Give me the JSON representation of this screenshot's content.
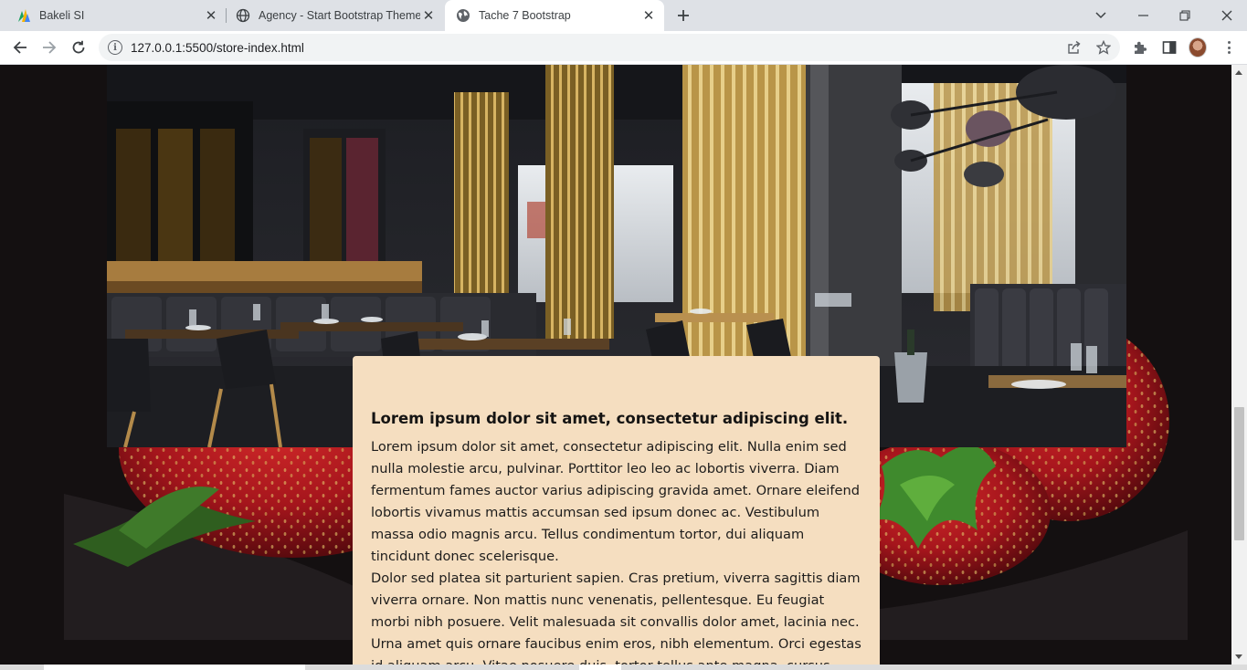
{
  "browser": {
    "tabs": [
      {
        "title": "Bakeli SI",
        "favicon": "bakeli-logo-icon",
        "active": false
      },
      {
        "title": "Agency - Start Bootstrap Theme",
        "favicon": "globe-icon",
        "active": false
      },
      {
        "title": "Tache 7 Bootstrap",
        "favicon": "globe-icon",
        "active": true
      }
    ],
    "address_bar": {
      "url": "127.0.0.1:5500/store-index.html"
    }
  },
  "page": {
    "card": {
      "heading": "Lorem ipsum dolor sit amet, consectetur adipiscing elit.",
      "paragraph1": "Lorem ipsum dolor sit amet, consectetur adipiscing elit. Nulla enim sed nulla molestie arcu, pulvinar. Porttitor leo leo ac lobortis viverra. Diam fermentum fames auctor varius adipiscing gravida amet. Ornare eleifend lobortis vivamus mattis accumsan sed ipsum donec ac. Vestibulum massa odio magnis arcu. Tellus condimentum tortor, dui aliquam tincidunt donec scelerisque.",
      "paragraph2": "Dolor sed platea sit parturient sapien. Cras pretium, viverra sagittis diam viverra ornare. Non mattis nunc venenatis, pellentesque. Eu feugiat morbi nibh posuere. Velit malesuada sit convallis dolor amet, lacinia nec. Urna amet quis ornare faucibus enim eros, nibh elementum. Orci egestas id aliquam arcu. Vitae posuere duis, tortor tellus ante magna, cursus morbi."
    }
  },
  "colors": {
    "page_background": "#141011",
    "card_background": "#f5dec0",
    "strawberry": "#b1141b"
  }
}
